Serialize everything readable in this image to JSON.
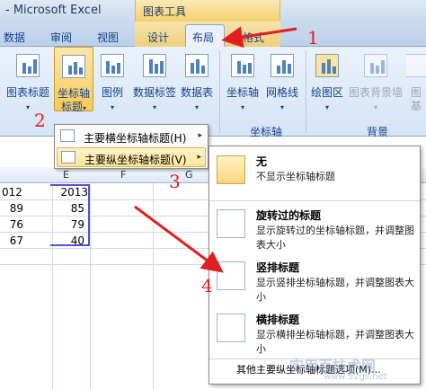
{
  "title_bar": {
    "app_title": "- Microsoft Excel",
    "context_header": "图表工具"
  },
  "tabs": [
    {
      "label": "数据"
    },
    {
      "label": "审阅"
    },
    {
      "label": "视图"
    },
    {
      "label": "设计"
    },
    {
      "label": "布局"
    },
    {
      "label": "格式"
    }
  ],
  "ribbon": {
    "buttons": [
      {
        "label": "图表标题"
      },
      {
        "label": "坐标轴"
      },
      {
        "label": "标题"
      },
      {
        "label": "图例"
      },
      {
        "label": "数据标签"
      },
      {
        "label": "数据表"
      },
      {
        "label": "坐标轴"
      },
      {
        "label": "网格线"
      },
      {
        "label": "绘图区"
      },
      {
        "label": "图表背景墙"
      },
      {
        "label": "图"
      },
      {
        "label": "基底"
      }
    ],
    "groups": [
      {
        "label": "坐标轴"
      },
      {
        "label": "背景"
      }
    ]
  },
  "sheet": {
    "column_headers": [
      "E",
      "F",
      "G"
    ],
    "header_fragment": "012",
    "rows": [
      {
        "d": "89",
        "e": "85"
      },
      {
        "d": "76",
        "e": "79"
      },
      {
        "d": "67",
        "e": "40"
      }
    ],
    "e_header": "2013"
  },
  "submenu": {
    "items": [
      {
        "label": "主要横坐标轴标题(H)",
        "shortcut_arrow": "▸"
      },
      {
        "label": "主要纵坐标轴标题(V)",
        "shortcut_arrow": "▸"
      }
    ]
  },
  "flyout": {
    "options": [
      {
        "title": "无",
        "desc": "不显示坐标轴标题"
      },
      {
        "title": "旋转过的标题",
        "desc": "显示旋转过的坐标轴标题，并调整图表大小"
      },
      {
        "title": "竖排标题",
        "desc": "显示竖排坐标轴标题，并调整图表大小"
      },
      {
        "title": "横排标题",
        "desc": "显示横排坐标轴标题，并调整图表大小"
      }
    ],
    "more": "其他主要纵坐标轴标题选项(M)..."
  },
  "annotations": {
    "n1": "1",
    "n2": "2",
    "n3": "3",
    "n4": "4"
  },
  "watermark": {
    "main": "实用百技术网",
    "url": "www.52gs.net"
  },
  "colors": {
    "accent": "#15428b",
    "context": "#f3cf6a",
    "arrow": "#e02020"
  }
}
